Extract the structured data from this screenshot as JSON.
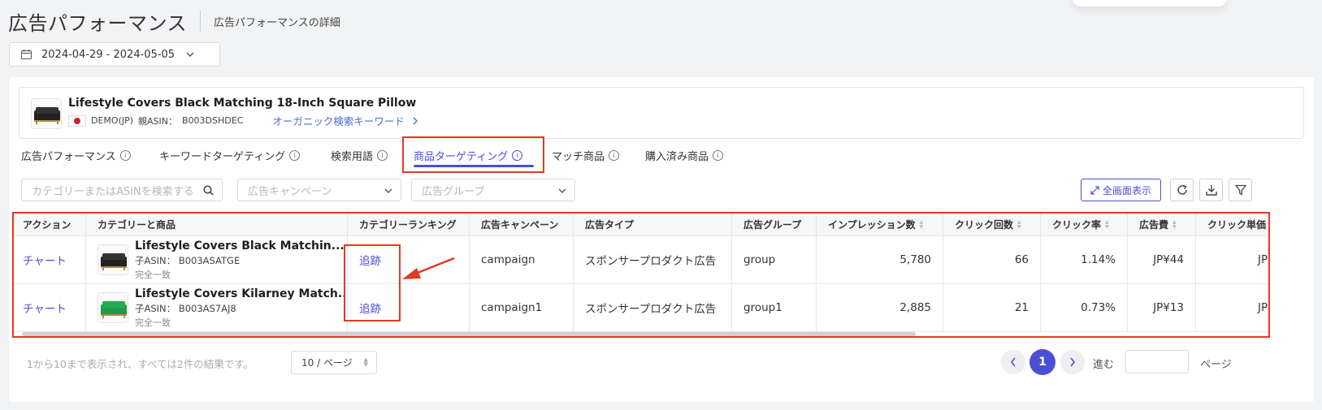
{
  "header": {
    "title": "広告パフォーマンス",
    "subtitle": "広告パフォーマンスの詳細",
    "date_range": "2024-04-29 - 2024-05-05"
  },
  "product": {
    "name": "Lifestyle Covers Black Matching 18-Inch Square Pillow",
    "marketplace": "DEMO(JP)",
    "parent_asin_label": "親ASIN：",
    "parent_asin": "B003DSHDEC",
    "organic_link": "オーガニック検索キーワード"
  },
  "tabs": [
    {
      "label": "広告パフォーマンス",
      "active": false
    },
    {
      "label": "キーワードターゲティング",
      "active": false
    },
    {
      "label": "検索用語",
      "active": false
    },
    {
      "label": "商品ターゲティング",
      "active": true
    },
    {
      "label": "マッチ商品",
      "active": false
    },
    {
      "label": "購入済み商品",
      "active": false
    }
  ],
  "filters": {
    "search_placeholder": "カテゴリーまたはASINを検索する",
    "campaign_placeholder": "広告キャンペーン",
    "group_placeholder": "広告グループ"
  },
  "toolbar": {
    "fullscreen_label": "全画面表示"
  },
  "table": {
    "columns": [
      "アクション",
      "カテゴリーと商品",
      "カテゴリーランキング",
      "広告キャンペーン",
      "広告タイプ",
      "広告グループ",
      "インプレッション数",
      "クリック回数",
      "クリック率",
      "広告費",
      "クリック単価"
    ],
    "rows": [
      {
        "action": "チャート",
        "product_name": "Lifestyle Covers Black Matchin...",
        "child_asin_label": "子ASIN：",
        "child_asin": "B003ASATGE",
        "match_type": "完全一致",
        "ranking": "追跡",
        "campaign": "campaign",
        "ad_type": "スポンサープロダクト広告",
        "group": "group",
        "impressions": "5,780",
        "clicks": "66",
        "ctr": "1.14%",
        "spend": "JP¥44",
        "cpc": "JP"
      },
      {
        "action": "チャート",
        "product_name": "Lifestyle Covers Kilarney Match...",
        "child_asin_label": "子ASIN：",
        "child_asin": "B003AS7AJ8",
        "match_type": "完全一致",
        "ranking": "追跡",
        "campaign": "campaign1",
        "ad_type": "スポンサープロダクト広告",
        "group": "group1",
        "impressions": "2,885",
        "clicks": "21",
        "ctr": "0.73%",
        "spend": "JP¥13",
        "cpc": "JP"
      }
    ]
  },
  "pagination": {
    "summary": "1から10まで表示され、すべては2件の結果です。",
    "page_size": "10 / ページ",
    "current_page": "1",
    "goto_label": "進む",
    "page_label": "ページ"
  },
  "colors": {
    "accent": "#4a4fd4",
    "highlight_box": "#e03b24",
    "link": "#4a6bdb"
  }
}
